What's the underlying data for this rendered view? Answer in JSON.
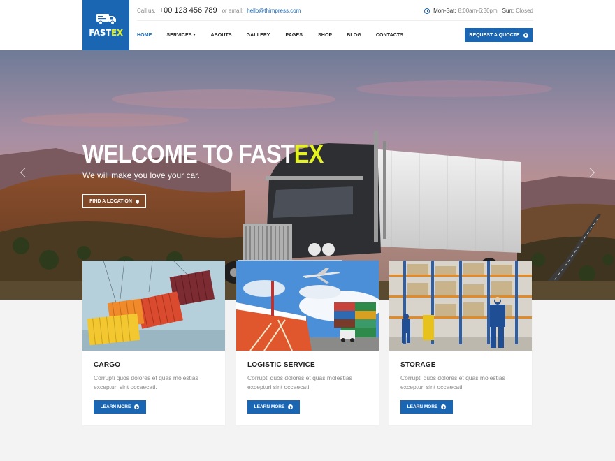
{
  "brand": {
    "name_a": "FAST",
    "name_b": "EX"
  },
  "topbar": {
    "call_label": "Call us.",
    "phone": "+00 123 456 789",
    "email_label": "or email:",
    "email": "hello@thimpress.com",
    "hours_days": "Mon-Sat:",
    "hours_time": "8:00am-6:30pm",
    "sunday_label": "Sun:",
    "sunday_value": "Closed"
  },
  "nav": {
    "items": [
      {
        "label": "HOME",
        "active": true
      },
      {
        "label": "SERVICES",
        "dropdown": true
      },
      {
        "label": "ABOUTS"
      },
      {
        "label": "GALLERY"
      },
      {
        "label": "PAGES"
      },
      {
        "label": "SHOP"
      },
      {
        "label": "BLOG"
      },
      {
        "label": "CONTACTS"
      }
    ],
    "cta": "REQUEST A QUOCTE"
  },
  "hero": {
    "title_a": "WELCOME TO FAST",
    "title_b": "EX",
    "subtitle": "We will make you love your car.",
    "button": "FIND A LOCATION"
  },
  "cards": [
    {
      "title": "CARGO",
      "desc": "Corrupti quos dolores et quas molestias excepturi sint occaecati.",
      "button": "LEARN MORE"
    },
    {
      "title": "LOGISTIC SERVICE",
      "desc": "Corrupti quos dolores et quas molestias excepturi sint occaecati.",
      "button": "LEARN MORE"
    },
    {
      "title": "STORAGE",
      "desc": "Corrupti quos dolores et quas molestias excepturi sint occaecati.",
      "button": "LEARN MORE"
    }
  ],
  "colors": {
    "primary": "#1a66b3",
    "accent": "#e4f21f"
  }
}
